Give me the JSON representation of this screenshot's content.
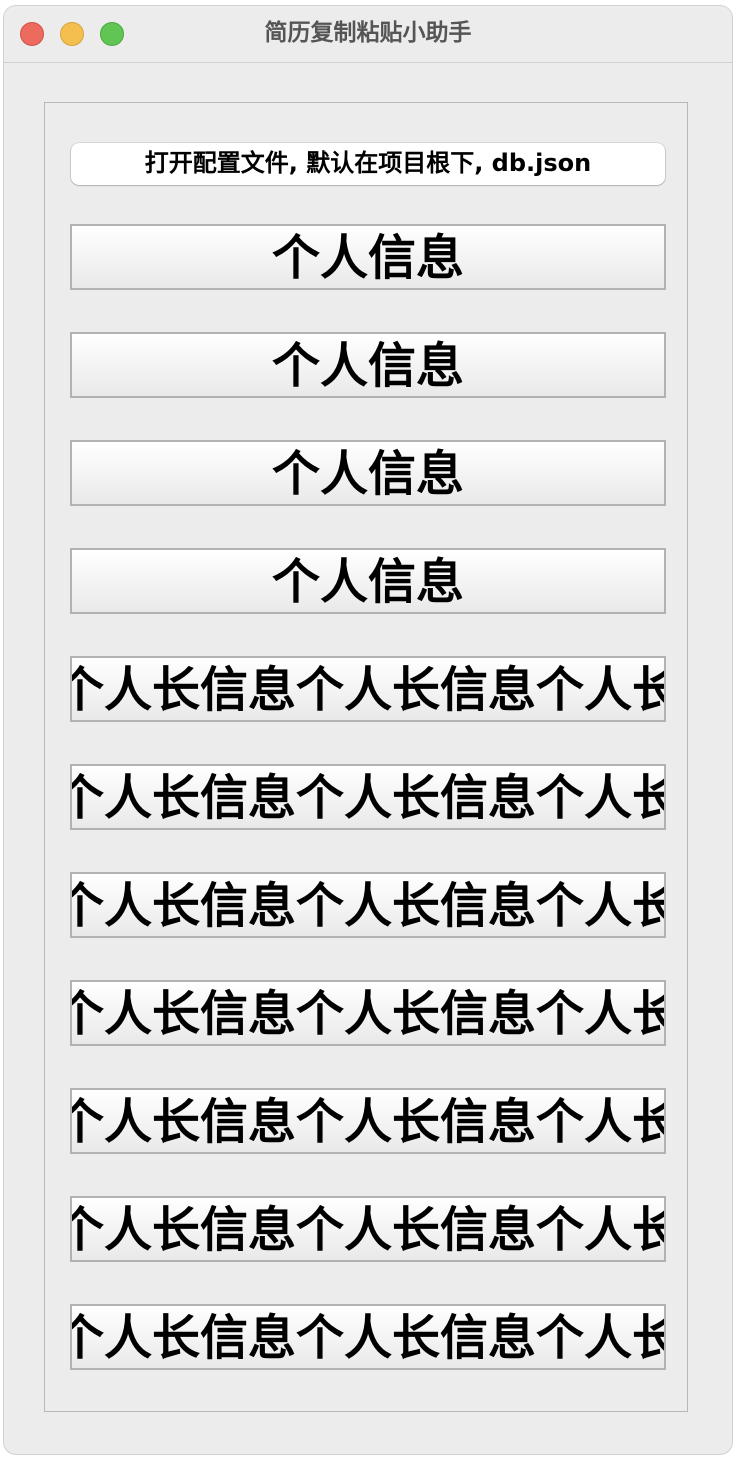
{
  "window": {
    "title": "简历复制粘贴小助手"
  },
  "toolbar": {
    "open_config_label": "打开配置文件, 默认在项目根下, db.json"
  },
  "items": [
    {
      "label": "个人信息"
    },
    {
      "label": "个人信息"
    },
    {
      "label": "个人信息"
    },
    {
      "label": "个人信息"
    },
    {
      "label": "个人长信息个人长信息个人长信息个人长信息个人长"
    },
    {
      "label": "个人长信息个人长信息个人长信息个人长信息个人长"
    },
    {
      "label": "个人长信息个人长信息个人长信息个人长信息个人长"
    },
    {
      "label": "个人长信息个人长信息个人长信息个人长信息个人长"
    },
    {
      "label": "个人长信息个人长信息个人长信息个人长信息个人长"
    },
    {
      "label": "个人长信息个人长信息个人长信息个人长信息个人长"
    },
    {
      "label": "个人长信息个人长信息个人长信息个人长信息个人长"
    }
  ],
  "colors": {
    "window_bg": "#ececec",
    "traffic_close": "#ec6a5e",
    "traffic_minimize": "#f4bf4f",
    "traffic_zoom": "#61c554"
  }
}
